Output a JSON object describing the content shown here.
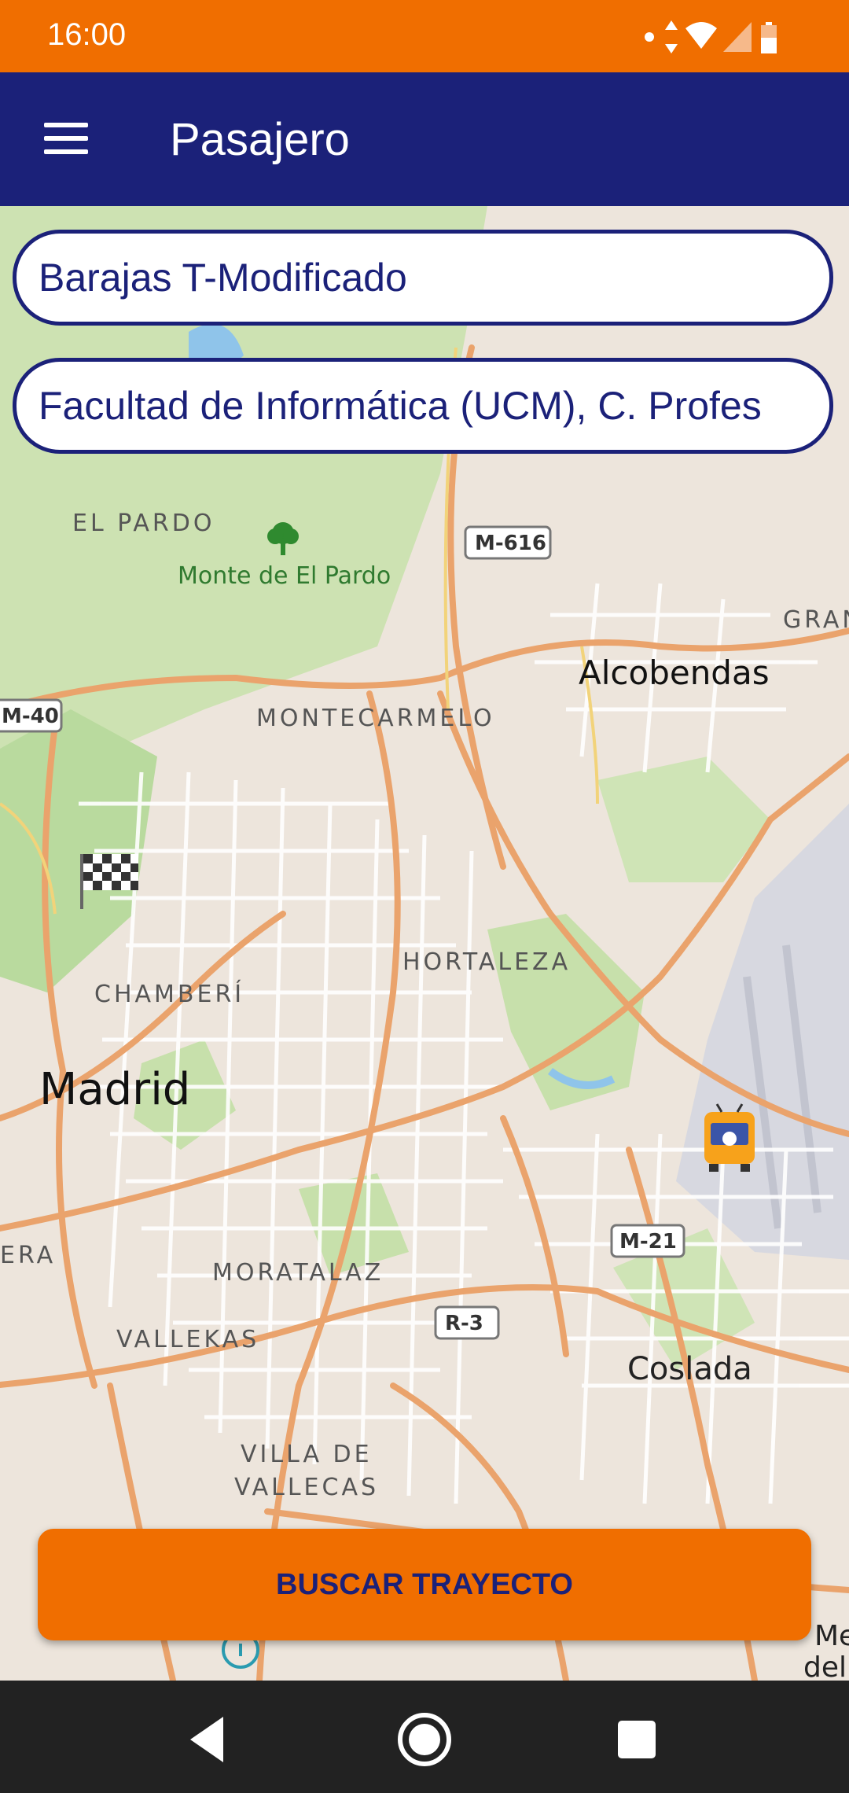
{
  "status_bar": {
    "time": "16:00",
    "icons": [
      "dot-icon",
      "data-arrows-icon",
      "wifi-icon",
      "signal-icon",
      "battery-icon"
    ]
  },
  "app_bar": {
    "title": "Pasajero",
    "menu_icon": "hamburger-menu-icon"
  },
  "route": {
    "origin_value": "Barajas T-Modificado",
    "destination_value": "Facultad de Informática (UCM), C. Profes"
  },
  "map": {
    "places": [
      {
        "label": "EL PARDO"
      },
      {
        "label": "Monte de El Pardo"
      },
      {
        "label": "Alcobendas"
      },
      {
        "label": "MONTECARMELO"
      },
      {
        "label": "GRAN"
      },
      {
        "label": "HORTALEZA"
      },
      {
        "label": "CHAMBERÍ"
      },
      {
        "label": "Madrid"
      },
      {
        "label": "ERA"
      },
      {
        "label": "MORATALAZ"
      },
      {
        "label": "VALLEKAS"
      },
      {
        "label": "Coslada"
      },
      {
        "label": "VILLA DE"
      },
      {
        "label": "VALLECAS"
      },
      {
        "label": "Me"
      },
      {
        "label": "del"
      }
    ],
    "road_shields": [
      {
        "label": "M-616"
      },
      {
        "label": "M-40"
      },
      {
        "label": "M-21"
      },
      {
        "label": "R-3"
      }
    ],
    "markers": {
      "destination": "checkered-flag-icon",
      "origin": "bus-icon",
      "poi": "tree-icon"
    }
  },
  "actions": {
    "search_label": "BUSCAR TRAYECTO"
  },
  "nav_bar": {
    "back": "back-triangle-icon",
    "home": "home-circle-icon",
    "recents": "recents-square-icon"
  },
  "colors": {
    "status_bar": "#f06e00",
    "app_bar": "#1b2179",
    "button": "#f06e00",
    "text_primary": "#1b2179"
  }
}
